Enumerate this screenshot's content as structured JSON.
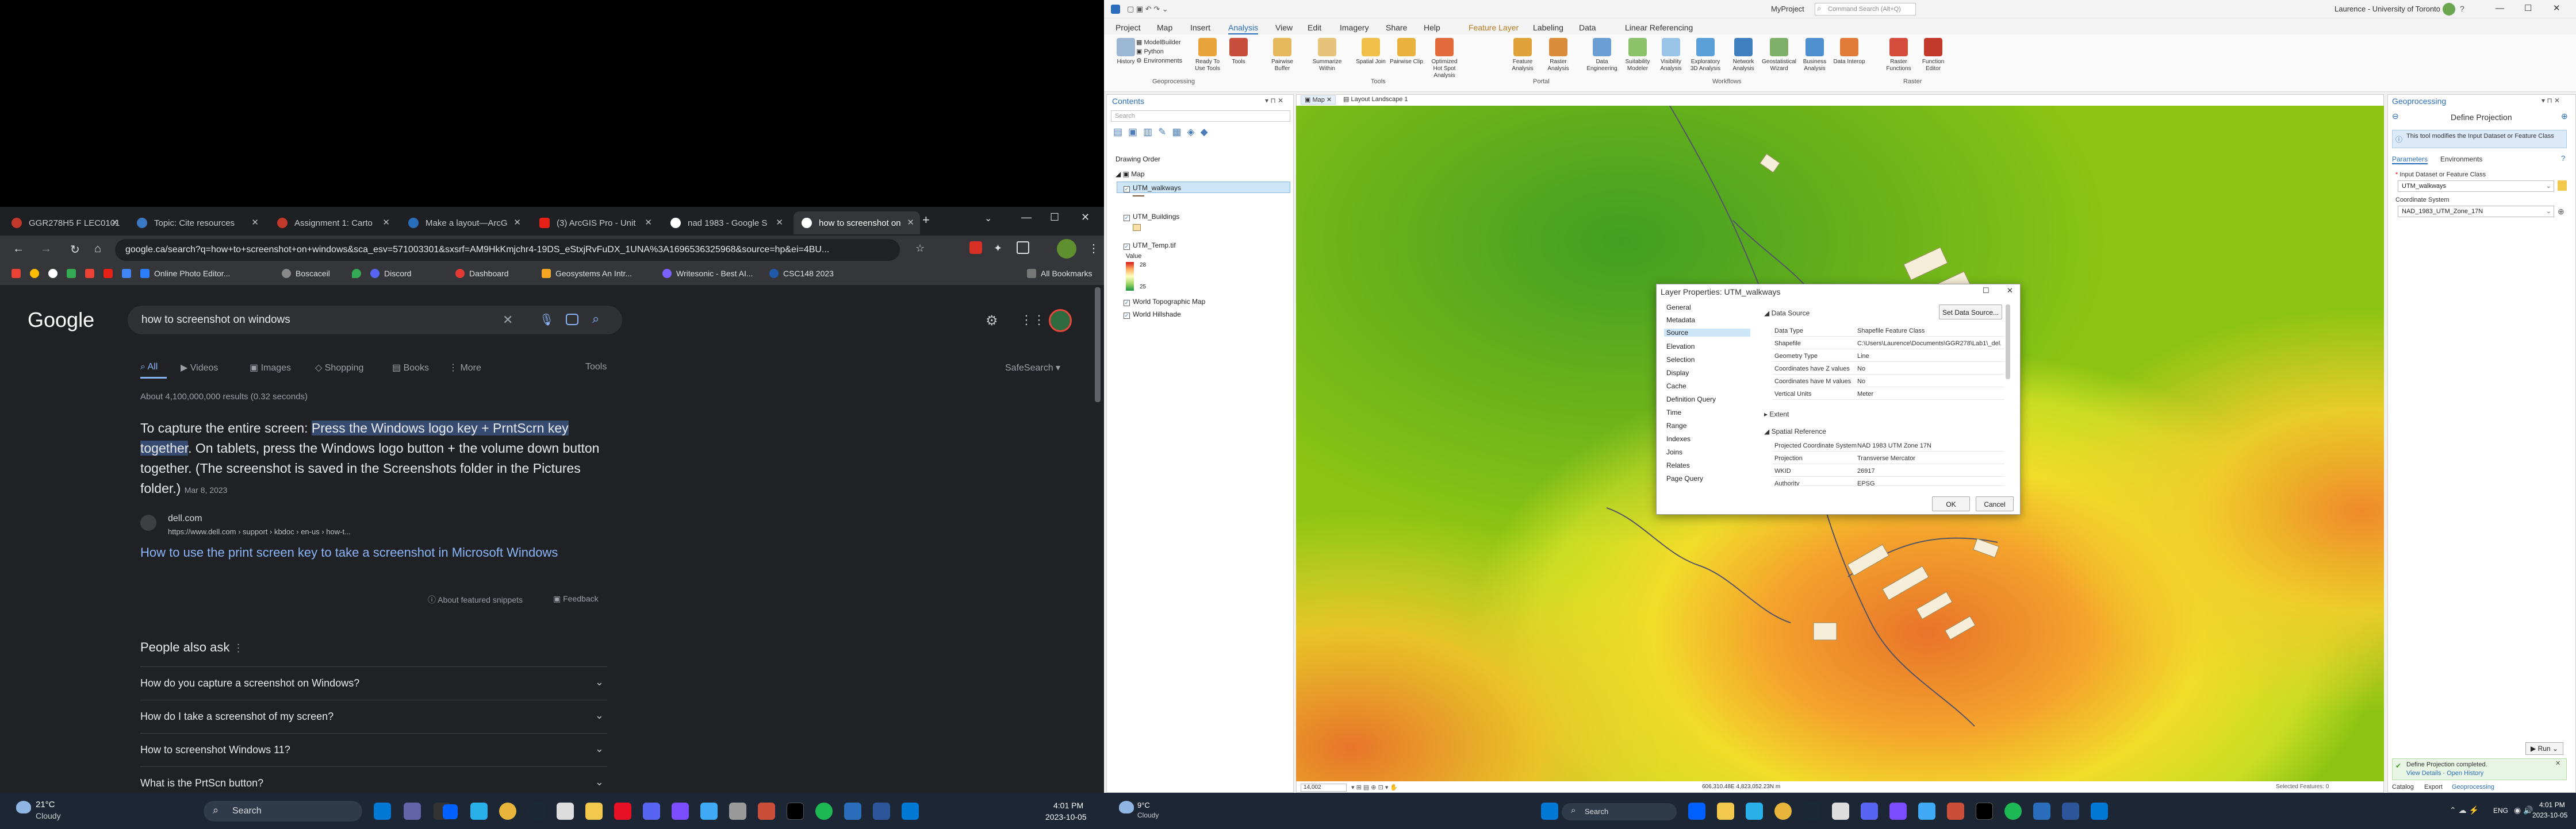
{
  "chrome": {
    "tabs": [
      {
        "label": "GGR278H5 F LEC0101"
      },
      {
        "label": "Topic: Cite resources"
      },
      {
        "label": "Assignment 1: Carto"
      },
      {
        "label": "Make a layout—ArcG"
      },
      {
        "label": "(3) ArcGIS Pro - Unit"
      },
      {
        "label": "nad 1983 - Google S"
      },
      {
        "label": "how to screenshot on"
      }
    ],
    "url": "google.ca/search?q=how+to+screenshot+on+windows&sca_esv=571003301&sxsrf=AM9HkKmjchr4-19DS_eStxjRvFuDX_1UNA%3A1696536325968&source=hp&ei=4BU...",
    "bookmarks": [
      "Online Photo Editor...",
      "Boscaceil",
      "Discord",
      "Dashboard",
      "Geosystems An Intr...",
      "Writesonic - Best AI...",
      "CSC148 2023"
    ],
    "all_bookmarks": "All Bookmarks"
  },
  "google": {
    "logo": "Google",
    "query": "how to screenshot on windows",
    "tabs": [
      "All",
      "Videos",
      "Images",
      "Shopping",
      "Books",
      "More"
    ],
    "tools": "Tools",
    "safesearch": "SafeSearch",
    "result_stats": "About 4,100,000,000 results (0.32 seconds)",
    "snippet_pre": "To capture the entire screen: ",
    "snippet_hl": "Press the Windows logo key + PrntScrn key together",
    "snippet_post": ". On tablets, press the Windows logo button + the volume down button together. (The screenshot is saved in the Screenshots folder in the Pictures folder.)",
    "snippet_date": "Mar 8, 2023",
    "source_site": "dell.com",
    "source_url": "https://www.dell.com › support › kbdoc › en-us › how-t...",
    "result_title": "How to use the print screen key to take a screenshot in Microsoft Windows",
    "about_snippets": "About featured snippets",
    "feedback": "Feedback",
    "paa_title": "People also ask",
    "paa": [
      "How do you capture a screenshot on Windows?",
      "How do I take a screenshot of my screen?",
      "How to screenshot Windows 11?",
      "What is the PrtScn button?"
    ]
  },
  "taskbar_left": {
    "temp": "21°C",
    "weather": "Cloudy",
    "search": "Search",
    "time": "4:01 PM",
    "date": "2023-10-05"
  },
  "arcgis": {
    "project": "MyProject",
    "command_search": "Command Search (Alt+Q)",
    "user": "Laurence - University of Toronto",
    "menu": [
      "Project",
      "Map",
      "Insert",
      "Analysis",
      "View",
      "Edit",
      "Imagery",
      "Share",
      "Help",
      "Feature Layer",
      "Labeling",
      "Data",
      "Linear Referencing"
    ],
    "ribbon_small": [
      "ModelBuilder",
      "Python",
      "Environments"
    ],
    "ribbon": [
      "History",
      "Ready To Use Tools",
      "Tools",
      "Pairwise Buffer",
      "Summarize Within",
      "Spatial Join",
      "Pairwise Clip",
      "Optimized Hot Spot Analysis",
      "Feature Analysis",
      "Raster Analysis",
      "Data Engineering",
      "Suitability Modeler",
      "Visibility Analysis",
      "Exploratory 3D Analysis",
      "Network Analysis",
      "Geostatistical Wizard",
      "Business Analysis",
      "Data Interop",
      "Raster Functions",
      "Function Editor"
    ],
    "groups": [
      "Geoprocessing",
      "Tools",
      "Portal",
      "Workflows",
      "Raster"
    ],
    "contents": {
      "title": "Contents",
      "search_placeholder": "Search",
      "drawing_order": "Drawing Order",
      "map": "Map",
      "layers": [
        "UTM_walkways",
        "UTM_Buildings",
        "UTM_Temp.tif"
      ],
      "value_label": "Value",
      "value_high": "28",
      "value_low": "25",
      "basemaps": [
        "World Topographic Map",
        "World Hillshade"
      ]
    },
    "view_tabs": [
      "Map",
      "Layout Landscape 1"
    ],
    "scale": "14,002",
    "coords": "606,310.48E 4,823,052.23N m",
    "selected_features": "Selected Features: 0",
    "dialog": {
      "title": "Layer Properties: UTM_walkways",
      "nav": [
        "General",
        "Metadata",
        "Source",
        "Elevation",
        "Selection",
        "Display",
        "Cache",
        "Definition Query",
        "Time",
        "Range",
        "Indexes",
        "Joins",
        "Relates",
        "Page Query"
      ],
      "data_source": "Data Source",
      "set_source": "Set Data Source...",
      "rows": [
        {
          "k": "Data Type",
          "v": "Shapefile Feature Class"
        },
        {
          "k": "Shapefile",
          "v": "C:\\Users\\Laurence\\Documents\\GGR278\\Lab1\\_del..."
        },
        {
          "k": "Geometry Type",
          "v": "Line"
        },
        {
          "k": "Coordinates have Z values",
          "v": "No"
        },
        {
          "k": "Coordinates have M values",
          "v": "No"
        },
        {
          "k": "Vertical Units",
          "v": "Meter"
        }
      ],
      "extent": "Extent",
      "spatial_ref": "Spatial Reference",
      "sr_rows": [
        {
          "k": "Projected Coordinate System",
          "v": "NAD 1983 UTM Zone 17N"
        },
        {
          "k": "Projection",
          "v": "Transverse Mercator"
        },
        {
          "k": "WKID",
          "v": "26917"
        },
        {
          "k": "Authority",
          "v": "EPSG"
        }
      ],
      "ok": "OK",
      "cancel": "Cancel"
    },
    "geoprocessing": {
      "title": "Geoprocessing",
      "tool": "Define Projection",
      "info": "This tool modifies the Input Dataset or Feature Class",
      "tabs": [
        "Parameters",
        "Environments"
      ],
      "input_label": "Input Dataset or Feature Class",
      "input_value": "UTM_walkways",
      "cs_label": "Coordinate System",
      "cs_value": "NAD_1983_UTM_Zone_17N",
      "run": "Run",
      "completed": "Define Projection completed.",
      "view_details": "View Details",
      "open_history": "Open History",
      "bottom_tabs": [
        "Catalog",
        "Export",
        "Geoprocessing"
      ]
    }
  },
  "taskbar_right": {
    "temp": "9°C",
    "weather": "Cloudy",
    "search": "Search",
    "lang": "ENG",
    "time": "4:01 PM",
    "date": "2023-10-05"
  }
}
